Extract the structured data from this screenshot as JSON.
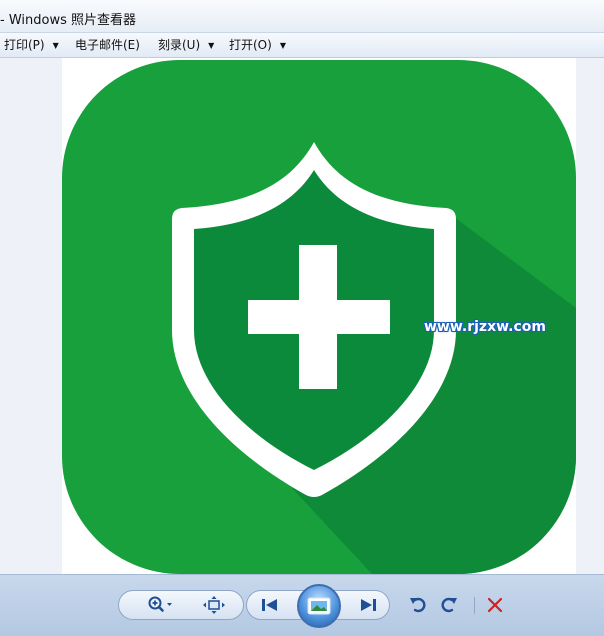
{
  "window": {
    "title": "- Windows 照片查看器"
  },
  "menu": {
    "items": [
      {
        "label": "打印(P)"
      },
      {
        "label": "电子邮件(E)"
      },
      {
        "label": "刻录(U)"
      },
      {
        "label": "打开(O)"
      }
    ]
  },
  "image": {
    "watermark": "www.rjzxw.com",
    "icon": "green-shield-plus-icon",
    "colors": {
      "background": "#17a03b",
      "shadow": "#0f8a38",
      "foreground": "#ffffff",
      "shield_inner": "#0c8a3b"
    }
  },
  "toolbar": {
    "icons": [
      "zoom-icon",
      "fit-to-window-icon",
      "previous-icon",
      "slideshow-icon",
      "next-icon",
      "rotate-counterclockwise-icon",
      "rotate-clockwise-icon",
      "delete-icon"
    ],
    "delete_color": "#cc2222"
  }
}
